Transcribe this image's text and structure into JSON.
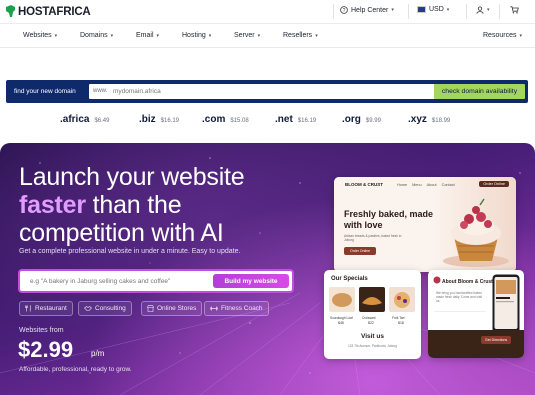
{
  "brand": {
    "name": "HOSTAFRICA"
  },
  "topbar": {
    "help_label": "Help Center",
    "currency_label": "USD"
  },
  "nav": {
    "items": [
      {
        "label": "Websites"
      },
      {
        "label": "Domains"
      },
      {
        "label": "Email"
      },
      {
        "label": "Hosting"
      },
      {
        "label": "Server"
      },
      {
        "label": "Resellers"
      }
    ],
    "right_label": "Resources"
  },
  "domain_search": {
    "label": "find your new domain",
    "prefix": "www.",
    "placeholder": "mydomain.africa",
    "button_label": "check domain availability"
  },
  "tlds": [
    {
      "name": ".africa",
      "price": "$6.49"
    },
    {
      "name": ".biz",
      "price": "$16.19"
    },
    {
      "name": ".com",
      "price": "$15.08"
    },
    {
      "name": ".net",
      "price": "$16.19"
    },
    {
      "name": ".org",
      "price": "$9.99"
    },
    {
      "name": ".xyz",
      "price": "$18.99"
    }
  ],
  "hero": {
    "line1": "Launch your website",
    "line2_highlight": "faster",
    "line2_rest": " than the",
    "line3": "competition with AI",
    "subtitle": "Get a complete professional website in under a minute. Easy to update.",
    "prompt_placeholder": "e.g \"A bakery in Jaburg selling cakes and coffee\"",
    "build_button": "Build my website",
    "chips": [
      {
        "label": "Restaurant",
        "icon": "utensils-icon"
      },
      {
        "label": "Consulting",
        "icon": "handshake-icon"
      },
      {
        "label": "Online Stores",
        "icon": "store-icon"
      },
      {
        "label": "Fitness Coach",
        "icon": "dumbbell-icon"
      }
    ],
    "price_prefix": "Websites from",
    "price": "$2.99",
    "price_unit": "p/m",
    "tagline": "Affordable, professional, ready to grow."
  },
  "preview": {
    "brand": "BLOOM & CRUST",
    "nav": [
      "Home",
      "Menu",
      "About",
      "Contact"
    ],
    "order_button": "Order Online",
    "headline": "Freshly baked, made with love",
    "headline_sub": "Artisan breads & pastries, baked fresh in Joburg",
    "cta": "Order Online",
    "specials_title": "Our Specials",
    "specials": [
      {
        "name": "Sourdough Loaf",
        "price": "$45"
      },
      {
        "name": "Croissant",
        "price": "$22"
      },
      {
        "name": "Fruit Tart",
        "price": "$18"
      }
    ],
    "visit_title": "Visit us",
    "visit_address": "123 7th Avenue, Parkhurst, Joburg",
    "about_title": "About Bloom & Crust",
    "about_text": "We bring you handcrafted bakes made fresh daily. Come and visit us.",
    "directions_button": "Get Directions"
  },
  "colors": {
    "brand_navy": "#0f2a6b",
    "accent_green": "#a4d65e",
    "hero_purple": "#4a1f7a",
    "highlight_pink": "#e29bff"
  }
}
